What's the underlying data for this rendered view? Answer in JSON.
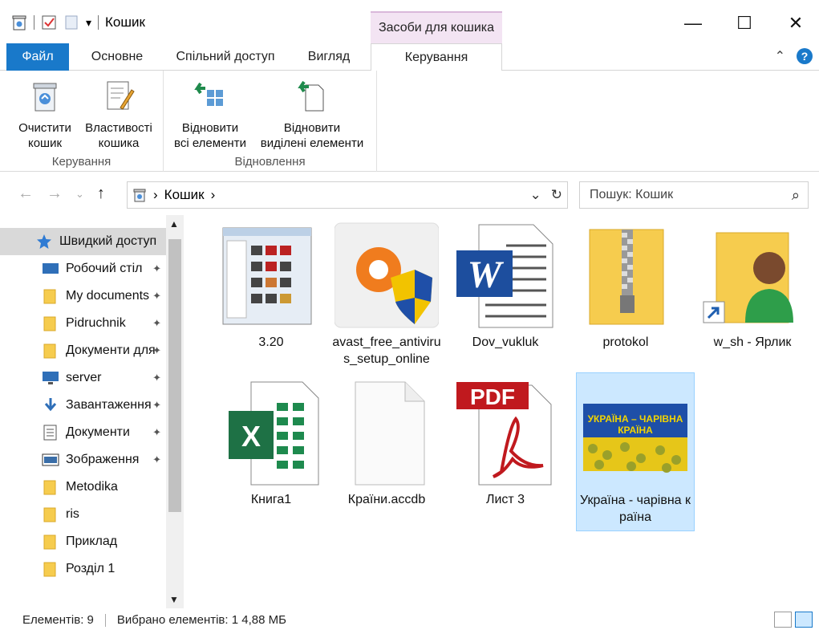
{
  "window": {
    "title": "Кошик",
    "context_tab": "Засоби для кошика",
    "minimize": "—",
    "maximize": "☐",
    "close": "✕"
  },
  "ribbon_tabs": [
    "Файл",
    "Основне",
    "Спільний доступ",
    "Вигляд",
    "Керування"
  ],
  "ribbon": {
    "groups": [
      {
        "label": "Керування",
        "buttons": [
          {
            "line1": "Очистити",
            "line2": "кошик",
            "icon": "recycle-bin-icon"
          },
          {
            "line1": "Властивості",
            "line2": "кошика",
            "icon": "properties-icon"
          }
        ]
      },
      {
        "label": "Відновлення",
        "buttons": [
          {
            "line1": "Відновити",
            "line2": "всі елементи",
            "icon": "restore-all-icon"
          },
          {
            "line1": "Відновити",
            "line2": "виділені елементи",
            "icon": "restore-selected-icon"
          }
        ]
      }
    ]
  },
  "address": {
    "path": "Кошик",
    "search_placeholder": "Пошук: Кошик"
  },
  "nav": {
    "items": [
      {
        "label": "Швидкий доступ",
        "icon": "star-icon",
        "pinned": false,
        "selected": true
      },
      {
        "label": "Робочий стіл",
        "icon": "desktop-icon",
        "pinned": true
      },
      {
        "label": "My documents",
        "icon": "folder-icon",
        "pinned": true
      },
      {
        "label": "Pidruchnik",
        "icon": "folder-icon",
        "pinned": true
      },
      {
        "label": "Документи для",
        "icon": "folder-icon",
        "pinned": true
      },
      {
        "label": "server",
        "icon": "monitor-icon",
        "pinned": true
      },
      {
        "label": "Завантаження",
        "icon": "download-icon",
        "pinned": true
      },
      {
        "label": "Документи",
        "icon": "documents-icon",
        "pinned": true
      },
      {
        "label": "Зображення",
        "icon": "pictures-icon",
        "pinned": true
      },
      {
        "label": "Metodika",
        "icon": "folder-icon",
        "pinned": false
      },
      {
        "label": "ris",
        "icon": "folder-icon",
        "pinned": false
      },
      {
        "label": "Приклад",
        "icon": "folder-icon",
        "pinned": false
      },
      {
        "label": "Розділ 1",
        "icon": "folder-icon",
        "pinned": false
      }
    ],
    "pin_glyph": "📌"
  },
  "files": [
    {
      "name": "3.20",
      "type": "screenshot-image"
    },
    {
      "name": "avast_free_antivirus_setup_online",
      "type": "avast-installer"
    },
    {
      "name": "Dov_vukluk",
      "type": "word-document"
    },
    {
      "name": "protokol",
      "type": "zip-folder"
    },
    {
      "name": "w_sh - Ярлик",
      "type": "user-shortcut"
    },
    {
      "name": "Книга1",
      "type": "excel-workbook"
    },
    {
      "name": "Країни.accdb",
      "type": "blank-file"
    },
    {
      "name": "Лист 3",
      "type": "pdf-document"
    },
    {
      "name": "Україна - чарівна країна",
      "type": "image-thumbnail",
      "selected": true,
      "thumb_caption": "УКРАЇНА – ЧАРІВНА КРАЇНА"
    }
  ],
  "status": {
    "count": "Елементів: 9",
    "selection": "Вибрано елементів: 1  4,88 МБ"
  },
  "colors": {
    "accent": "#1979ca",
    "selection_bg": "#cce8ff",
    "context_tab": "#f3e4f3"
  }
}
